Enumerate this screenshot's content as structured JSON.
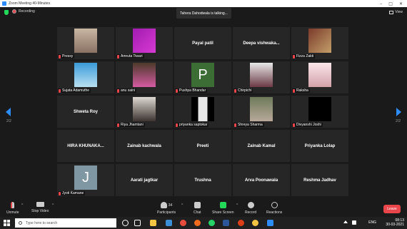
{
  "window": {
    "title": "Zoom Meeting 40-Minutes"
  },
  "topbar": {
    "recording_label": "Recording",
    "talking_label": "Tahera Dahodwala is talking...",
    "view_label": "View"
  },
  "pagination": {
    "left": "2/2",
    "right": "2/2"
  },
  "tiles": [
    {
      "label": "Pressy",
      "type": "video"
    },
    {
      "label": "Amruta Tiwari",
      "type": "video"
    },
    {
      "name": "Payal patil",
      "type": "name"
    },
    {
      "name": "Deepa  vishwaka...",
      "type": "name"
    },
    {
      "label": "Fizza Zakti",
      "type": "video"
    },
    {
      "label": "Sujata Adamuthe",
      "type": "video"
    },
    {
      "label": "anu saini",
      "type": "video"
    },
    {
      "label": "Pushpa Bhandar",
      "type": "avatar",
      "initial": "P"
    },
    {
      "label": "Chirpichi",
      "type": "video"
    },
    {
      "label": "Raksha",
      "type": "video"
    },
    {
      "name": "Shweta Roy",
      "type": "name"
    },
    {
      "label": "Riya Jhamtani",
      "type": "video"
    },
    {
      "label": "priyanka saptokar",
      "type": "video"
    },
    {
      "label": "Shreya Sharma",
      "type": "video"
    },
    {
      "label": "Divyanshi Joshi",
      "type": "video"
    },
    {
      "name": "HIRA  KHUNAKA...",
      "type": "name"
    },
    {
      "name": "Zainab kachwala",
      "type": "name"
    },
    {
      "name": "Preeti",
      "type": "name"
    },
    {
      "name": "Zainab Kamal",
      "type": "name"
    },
    {
      "name": "Priyanka Lolap",
      "type": "name"
    },
    {
      "label": "Jyoti Kamane",
      "type": "avatar",
      "initial": "J"
    },
    {
      "name": "Aarati jagtkar",
      "type": "name"
    },
    {
      "name": "Trushna",
      "type": "name"
    },
    {
      "name": "Arva Poonawala",
      "type": "name"
    },
    {
      "name": "Reshma Jadhav",
      "type": "name"
    }
  ],
  "toolbar": {
    "unmute": "Unmute",
    "stop_video": "Stop Video",
    "participants": "Participants",
    "participant_count": "34",
    "chat": "Chat",
    "share_screen": "Share Screen",
    "record": "Record",
    "reactions": "Reactions",
    "leave": "Leave"
  },
  "taskbar": {
    "search_placeholder": "Type here to search",
    "lang": "ENG",
    "time": "08:13",
    "date": "30-03-2021"
  },
  "colors": {
    "accent_blue": "#2d8cff",
    "muted_red": "#e8464b",
    "share_green": "#23d959",
    "tile_bg": "#262626"
  }
}
